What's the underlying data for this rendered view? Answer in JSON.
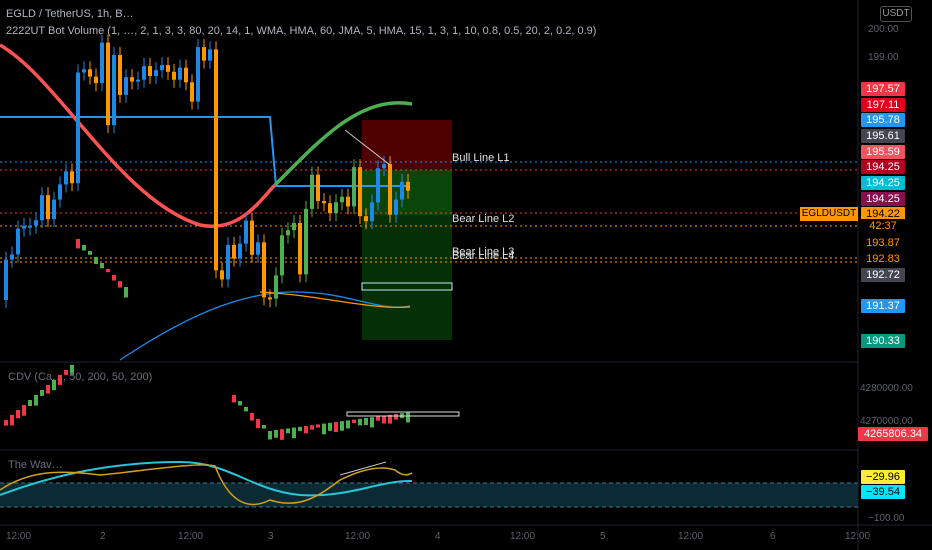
{
  "header": {
    "title": "EGLD / TetherUS, 1h, B…",
    "indicator": "2222UT Bot Volume (1, …, 2, 1, 3, 3, 80, 20, 14, 1, WMA, HMA, 60, JMA, 5, HMA, 15, 1, 3, 1, 10, 0.8, 0.5, 20, 2, 0.2, 0.9)",
    "currency": "USDT"
  },
  "sub_panels": {
    "cdv_label": "CDV (Ca…, 50, 200, 50, 200)",
    "wave_label": "The Wav…"
  },
  "line_labels": {
    "bull_l1": "Bull Line L1",
    "bear_l2": "Bear Line L2",
    "bear_l3": "Bear Line L3",
    "bear_l4": "Bear Line L4"
  },
  "symbol_tag": "EGLDUSDT",
  "price_axis": {
    "ticks": [
      "200.00",
      "199.00",
      "4280000.00",
      "4270000.00",
      "−100.00"
    ],
    "badges": [
      {
        "label": "197.57",
        "color": "#f23645"
      },
      {
        "label": "197.11",
        "color": "#e0001b"
      },
      {
        "label": "195.78",
        "color": "#2196f3"
      },
      {
        "label": "195.61",
        "color": "#434651"
      },
      {
        "label": "195.59",
        "color": "#f7525f"
      },
      {
        "label": "194.25",
        "color": "#b2001f"
      },
      {
        "label": "194.25",
        "color": "#00bcd4"
      },
      {
        "label": "194.25",
        "color": "#880e4f"
      },
      {
        "label": "194.22",
        "color": "#ff9800"
      },
      {
        "label": "42:37",
        "color": "#ff9800"
      },
      {
        "label": "193.87",
        "color": "#ff9800"
      },
      {
        "label": "192.83",
        "color": "#ff9800"
      },
      {
        "label": "192.72",
        "color": "#434651"
      },
      {
        "label": "191.37",
        "color": "#2196f3"
      },
      {
        "label": "190.33",
        "color": "#089981"
      },
      {
        "label": "4265806.34",
        "color": "#f23645"
      },
      {
        "label": "−29.96",
        "color": "#ffeb3b"
      },
      {
        "label": "−39.54",
        "color": "#00e5ff"
      }
    ]
  },
  "time_axis": [
    "12:00",
    "2",
    "12:00",
    "3",
    "12:00",
    "4",
    "12:00",
    "5",
    "12:00",
    "6",
    "12:00"
  ]
}
